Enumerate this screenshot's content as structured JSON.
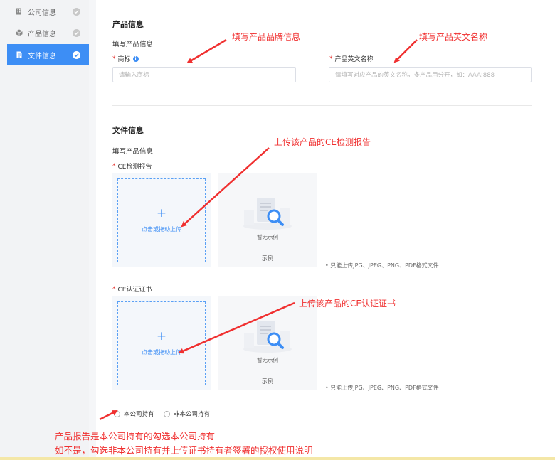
{
  "sidebar": {
    "items": [
      {
        "label": "公司信息",
        "icon": "building-icon",
        "active": false
      },
      {
        "label": "产品信息",
        "icon": "cube-icon",
        "active": false
      },
      {
        "label": "文件信息",
        "icon": "document-icon",
        "active": true
      }
    ]
  },
  "product": {
    "title": "产品信息",
    "subtitle": "填写产品信息",
    "brand_label": "商标",
    "brand_placeholder": "请输入商标",
    "en_label": "产品英文名称",
    "en_placeholder": "请填写对应产品的英文名称，多产品用分开，如：AAA;888"
  },
  "files": {
    "title": "文件信息",
    "subtitle": "填写产品信息",
    "uploads": [
      {
        "label": "CE检测报告",
        "upload_text": "点击或拖动上传",
        "example_empty": "暂无示例",
        "example_caption": "示例",
        "hint": "• 只能上传JPG、JPEG、PNG、PDF格式文件"
      },
      {
        "label": "CE认证证书",
        "upload_text": "点击或拖动上传",
        "example_empty": "暂无示例",
        "example_caption": "示例",
        "hint": "• 只能上传JPG、JPEG、PNG、PDF格式文件"
      }
    ],
    "ownership": {
      "options": [
        "本公司持有",
        "非本公司持有"
      ]
    }
  },
  "annotations": {
    "brand": "填写产品品牌信息",
    "en_name": "填写产品英文名称",
    "ce_report": "上传该产品的CE检测报告",
    "ce_cert": "上传该产品的CE认证证书",
    "ownership_line1": "产品报告是本公司持有的勾选本公司持有",
    "ownership_line2": "如不是，勾选非本公司持有并上传证书持有者签署的授权使用说明"
  },
  "colors": {
    "accent": "#3d8ef5",
    "annotation": "#f03030",
    "required": "#e53935"
  }
}
